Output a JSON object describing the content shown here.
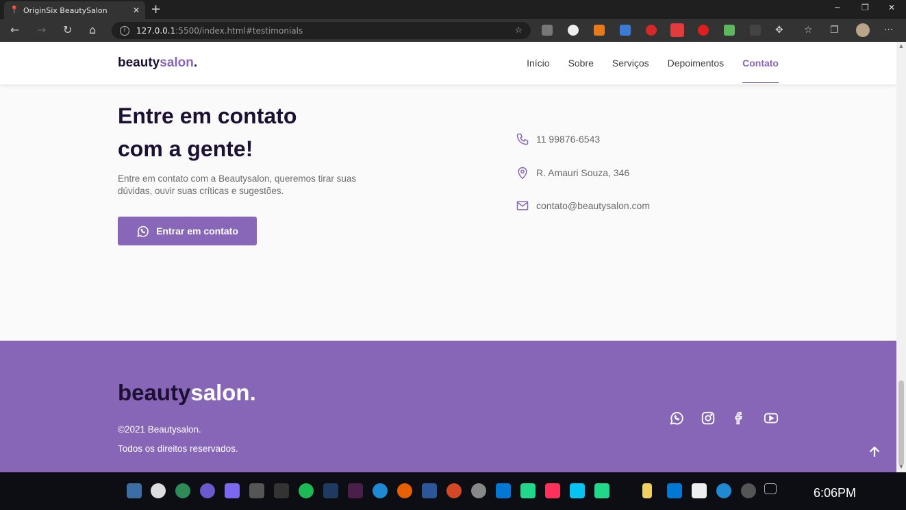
{
  "browser": {
    "tab_title": "OriginSix BeautySalon",
    "url_host": "127.0.0.1",
    "url_rest": ":5500/index.html#testimonials"
  },
  "site": {
    "logo_main": "beauty",
    "logo_accent": "salon",
    "logo_dot": ".",
    "nav": [
      {
        "label": "Início",
        "active": false
      },
      {
        "label": "Sobre",
        "active": false
      },
      {
        "label": "Serviços",
        "active": false
      },
      {
        "label": "Depoimentos",
        "active": false
      },
      {
        "label": "Contato",
        "active": true
      }
    ]
  },
  "contact": {
    "title": "Entre em contato com a gente!",
    "description": "Entre em contato com a Beautysalon, queremos tirar suas dúvidas, ouvir suas críticas e sugestões.",
    "button_label": "Entrar em contato",
    "phone": "11 99876-6543",
    "address": "R. Amauri Souza, 346",
    "email": "contato@beautysalon.com"
  },
  "footer": {
    "copyright": "©2021 Beautysalon.",
    "rights": "Todos os direitos reservados.",
    "socials": [
      "whatsapp-icon",
      "instagram-icon",
      "facebook-icon",
      "youtube-icon"
    ]
  },
  "taskbar": {
    "time": "6:06PM"
  },
  "colors": {
    "accent": "#8866b8",
    "dark": "#1c1033",
    "footer_bg": "#8766b8"
  }
}
